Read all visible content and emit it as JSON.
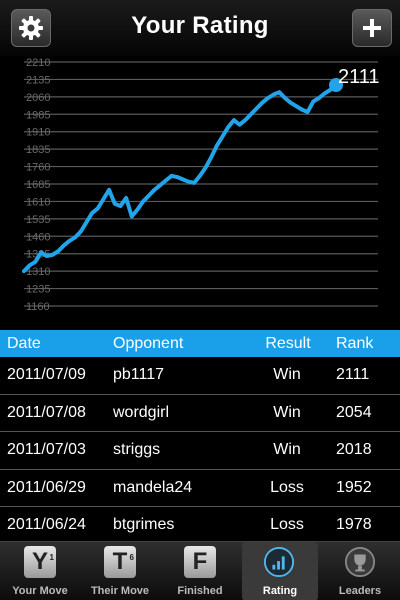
{
  "header": {
    "title": "Your Rating",
    "settings_icon": "gear-icon",
    "add_icon": "plus-icon"
  },
  "chart_data": {
    "type": "line",
    "y_ticks": [
      "2210",
      "2135",
      "2060",
      "1985",
      "1910",
      "1835",
      "1760",
      "1685",
      "1610",
      "1535",
      "1460",
      "1385",
      "1310",
      "1235",
      "1160"
    ],
    "ylim": [
      1160,
      2210
    ],
    "series": [
      {
        "values": [
          1310,
          1335,
          1350,
          1390,
          1375,
          1380,
          1395,
          1420,
          1440,
          1455,
          1480,
          1520,
          1560,
          1580,
          1620,
          1660,
          1600,
          1590,
          1625,
          1545,
          1575,
          1610,
          1635,
          1660,
          1680,
          1700,
          1720,
          1715,
          1705,
          1695,
          1690,
          1720,
          1755,
          1800,
          1850,
          1890,
          1930,
          1960,
          1940,
          1960,
          1985,
          2010,
          2035,
          2055,
          2070,
          2080,
          2055,
          2035,
          2020,
          2005,
          1995,
          2040,
          2055,
          2075,
          2090,
          2111
        ]
      }
    ],
    "last_value_label": "2111",
    "line_color": "#22a4ea"
  },
  "table": {
    "headers": {
      "date": "Date",
      "opponent": "Opponent",
      "result": "Result",
      "rank": "Rank"
    },
    "rows": [
      {
        "date": "2011/07/09",
        "opponent": "pb1117",
        "result": "Win",
        "rank": "2111"
      },
      {
        "date": "2011/07/08",
        "opponent": "wordgirl",
        "result": "Win",
        "rank": "2054"
      },
      {
        "date": "2011/07/03",
        "opponent": "striggs",
        "result": "Win",
        "rank": "2018"
      },
      {
        "date": "2011/06/29",
        "opponent": "mandela24",
        "result": "Loss",
        "rank": "1952"
      },
      {
        "date": "2011/06/24",
        "opponent": "btgrimes",
        "result": "Loss",
        "rank": "1978"
      }
    ]
  },
  "tabs": [
    {
      "label": "Your Move",
      "glyph": "Y",
      "sup": "1",
      "icon": "your-move-icon"
    },
    {
      "label": "Their Move",
      "glyph": "T",
      "sup": "6",
      "icon": "their-move-icon"
    },
    {
      "label": "Finished",
      "glyph": "F",
      "sup": "",
      "icon": "finished-icon"
    },
    {
      "label": "Rating",
      "glyph": "",
      "sup": "",
      "icon": "rating-chart-icon",
      "active": true
    },
    {
      "label": "Leaders",
      "glyph": "",
      "sup": "",
      "icon": "trophy-icon"
    }
  ]
}
